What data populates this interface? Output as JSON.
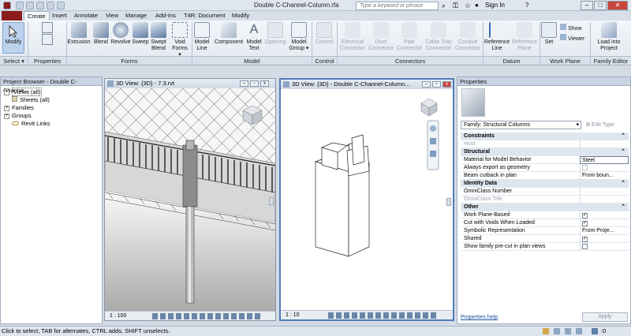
{
  "app": {
    "window_title": "Double C-Channel-Column.rfa",
    "search_placeholder": "Type a keyword or phrase",
    "sign_in": "Sign In"
  },
  "tabs": [
    "Create",
    "Insert",
    "Annotate",
    "View",
    "Manage",
    "Add-Ins",
    "T4R: Document",
    "Modify"
  ],
  "ribbon": {
    "select": {
      "modify": "Modify",
      "select_label": "Select ▾"
    },
    "groups": {
      "properties": "Properties",
      "forms": "Forms",
      "model": "Model",
      "control": "Control",
      "connectors": "Connectors",
      "datum": "Datum",
      "work_plane": "Work Plane",
      "family_editor": "Family Editor"
    },
    "forms": [
      "Extrusion",
      "Blend",
      "Revolve",
      "Sweep",
      "Swept Blend",
      "Void Forms ▾"
    ],
    "model": [
      "Model Line",
      "Component",
      "Model Text",
      "Opening",
      "Model Group ▾"
    ],
    "control": [
      "Control"
    ],
    "connectors": [
      "Electrical Connector",
      "Duct Connector",
      "Pipe Connector",
      "Cable Tray Connector",
      "Conduit Connector"
    ],
    "datum": [
      "Reference Line",
      "Reference Plane"
    ],
    "work_plane": {
      "set": "Set",
      "show": "Show",
      "viewer": "Viewer"
    },
    "family_editor": {
      "load": "Load into Project"
    }
  },
  "project_browser": {
    "title": "Project Browser - Double C-Channe...",
    "items": [
      {
        "label": "Views (all)",
        "expand": "+"
      },
      {
        "label": "Sheets (all)",
        "expand": ""
      },
      {
        "label": "Families",
        "expand": "+"
      },
      {
        "label": "Groups",
        "expand": "+"
      },
      {
        "label": "Revit Links",
        "expand": ""
      }
    ]
  },
  "views": {
    "left": {
      "title": "3D View: {3D} - 7.3.rvt",
      "scale": "1 : 100"
    },
    "right": {
      "title": "3D View: {3D} - Double C-Channel-Column...",
      "scale": "1 : 10"
    }
  },
  "properties": {
    "title": "Properties",
    "family_dropdown": "Family: Structural Columns",
    "edit_type": "Edit Type",
    "rows": [
      {
        "type": "section",
        "label": "Constraints"
      },
      {
        "type": "field",
        "label": "Host",
        "value": "",
        "disabled": true
      },
      {
        "type": "section",
        "label": "Structural"
      },
      {
        "type": "field",
        "label": "Material for Model Behavior",
        "value": "Steel"
      },
      {
        "type": "check",
        "label": "Always export as geometry",
        "checked": false
      },
      {
        "type": "field",
        "label": "Beam cutback in plan",
        "value": "From boun..."
      },
      {
        "type": "section",
        "label": "Identity Data"
      },
      {
        "type": "field",
        "label": "OmniClass Number",
        "value": ""
      },
      {
        "type": "field",
        "label": "OmniClass Title",
        "value": "",
        "disabled": true
      },
      {
        "type": "section",
        "label": "Other"
      },
      {
        "type": "check",
        "label": "Work Plane-Based",
        "checked": true
      },
      {
        "type": "check",
        "label": "Cut with Voids When Loaded",
        "checked": true
      },
      {
        "type": "field",
        "label": "Symbolic Representation",
        "value": "From Proje..."
      },
      {
        "type": "check",
        "label": "Shared",
        "checked": true
      },
      {
        "type": "check",
        "label": "Show family pre-cut in plan views",
        "checked": false
      }
    ],
    "help_link": "Properties help",
    "apply": "Apply"
  },
  "status_bar": {
    "text": "Click to select, TAB for alternates, CTRL adds, SHIFT unselects.",
    "filter_count": ":0"
  },
  "colors": {
    "accent": "#4f7db8",
    "ribbon_bg": "#e8edf3"
  }
}
